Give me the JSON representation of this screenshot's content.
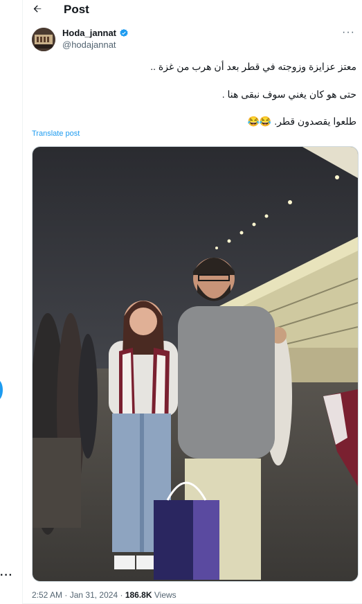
{
  "header": {
    "title": "Post"
  },
  "author": {
    "name": "Hoda_jannat",
    "handle": "@hodajannat"
  },
  "post": {
    "lines": [
      "معتز عزايزة وزوجته في قطر بعد أن هرب من غزة ..",
      "حتى هو كان يغني سوف نبقى هنا .",
      "طلعوا يقصدون قطر. 😂😂"
    ],
    "translate_label": "Translate post"
  },
  "meta": {
    "time": "2:52 AM",
    "separator": "·",
    "date": "Jan 31, 2024",
    "views_count": "186.8K",
    "views_label": "Views"
  },
  "icons": {
    "back": "arrow-left-icon",
    "verified": "verified-badge-icon",
    "more": "more-horizontal-icon"
  },
  "colors": {
    "accent": "#1d9bf0",
    "text": "#0f1419",
    "muted": "#536471"
  }
}
